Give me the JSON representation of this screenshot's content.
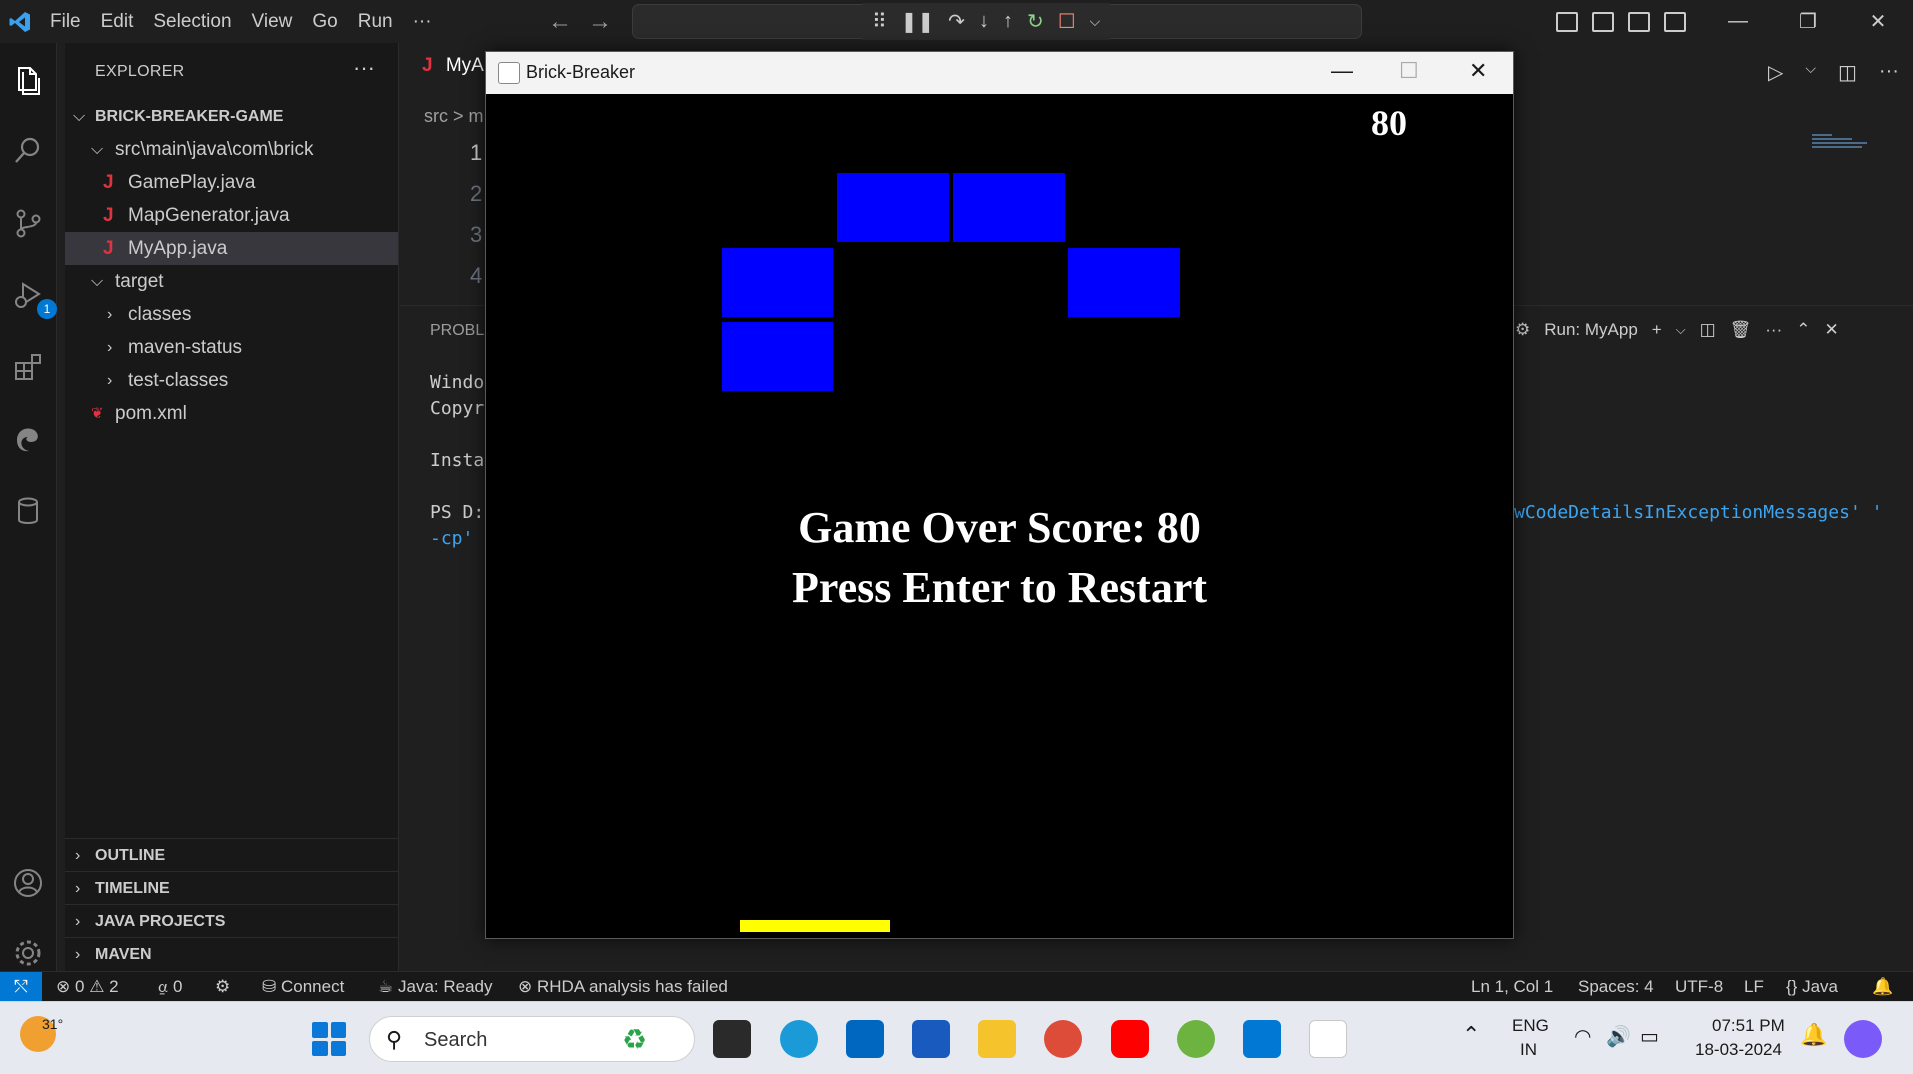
{
  "menu": {
    "file": "File",
    "edit": "Edit",
    "selection": "Selection",
    "view": "View",
    "go": "Go",
    "run": "Run",
    "more": "···"
  },
  "explorer": {
    "title": "EXPLORER",
    "more": "···",
    "project": "BRICK-BREAKER-GAME",
    "folder_path": "src\\main\\java\\com\\brick",
    "files": [
      "GamePlay.java",
      "MapGenerator.java",
      "MyApp.java"
    ],
    "target": "target",
    "target_children": [
      "classes",
      "maven-status",
      "test-classes"
    ],
    "pom": "pom.xml",
    "sections": [
      "OUTLINE",
      "TIMELINE",
      "JAVA PROJECTS",
      "MAVEN"
    ]
  },
  "activity": {
    "debug_badge": "1"
  },
  "editor": {
    "tab_label": "MyA",
    "breadcrumb_src": "src",
    "breadcrumb_sep": "> m",
    "line_numbers": [
      "1",
      "2",
      "3",
      "4"
    ]
  },
  "panel": {
    "tab_label": "PROBLE",
    "lines": [
      "Windo",
      "Copyr",
      "Insta",
      "PS D:"
    ],
    "cp_line": "-cp'",
    "right_line": "wCodeDetailsInExceptionMessages' '",
    "run_label": "Run: MyApp"
  },
  "game": {
    "window_title": "Brick-Breaker",
    "score": "80",
    "game_over_line": "Game Over Score: 80",
    "restart_line": "Press Enter to Restart",
    "colors": {
      "brick": "#0000ff",
      "paddle": "#ffff00",
      "background": "#000000"
    }
  },
  "statusbar": {
    "errors": "0",
    "warnings": "2",
    "ports": "0",
    "connect": "Connect",
    "java_status": "Java: Ready",
    "rhda": "RHDA analysis has failed",
    "position": "Ln 1, Col 1",
    "spaces": "Spaces: 4",
    "encoding": "UTF-8",
    "eol": "LF",
    "language": "Java"
  },
  "taskbar": {
    "temperature": "31°",
    "search_placeholder": "Search",
    "lang_top": "ENG",
    "lang_bottom": "IN",
    "time": "07:51 PM",
    "date": "18-03-2024"
  }
}
